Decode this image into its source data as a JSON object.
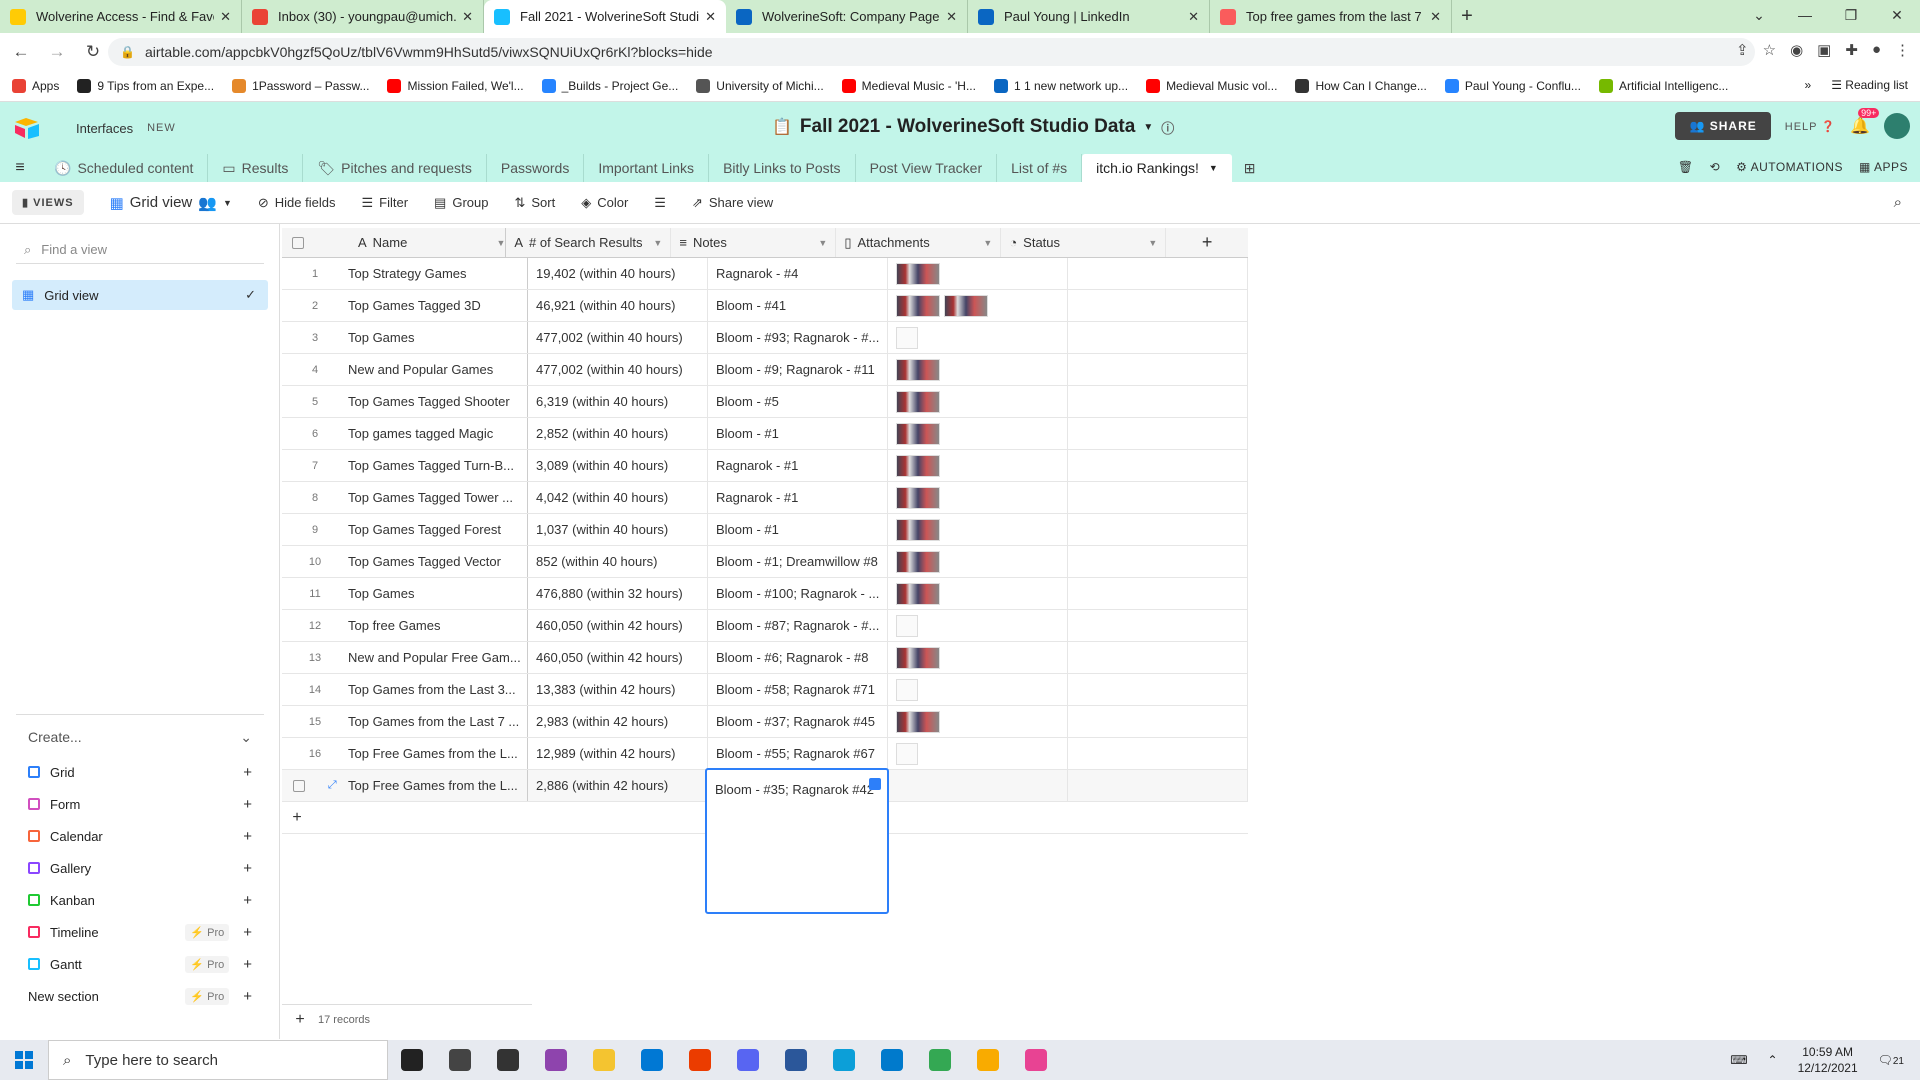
{
  "browser": {
    "tabs": [
      {
        "title": "Wolverine Access - Find & Favori",
        "icon": "umich-icon",
        "color": "#ffcb05",
        "active": false
      },
      {
        "title": "Inbox (30) - youngpau@umich.ec",
        "icon": "gmail-icon",
        "color": "#ea4335",
        "active": false
      },
      {
        "title": "Fall 2021 - WolverineSoft Studio",
        "icon": "airtable-icon",
        "color": "#18bfff",
        "active": true
      },
      {
        "title": "WolverineSoft: Company Page Ac",
        "icon": "linkedin-icon",
        "color": "#0a66c2",
        "active": false
      },
      {
        "title": "Paul Young | LinkedIn",
        "icon": "linkedin-icon",
        "color": "#0a66c2",
        "active": false
      },
      {
        "title": "Top free games from the last 7 d",
        "icon": "itchio-icon",
        "color": "#fa5c5c",
        "active": false
      }
    ],
    "url": "airtable.com/appcbkV0hgzf5QoUz/tblV6Vwmm9HhSutd5/viwxSQNUiUxQr6rKl?blocks=hide",
    "bookmarks": [
      {
        "label": "Apps",
        "color": "#e94235"
      },
      {
        "label": "9 Tips from an Expe...",
        "color": "#222222"
      },
      {
        "label": "1Password – Passw...",
        "color": "#e5892b"
      },
      {
        "label": "Mission Failed, We'l...",
        "color": "#ff0000"
      },
      {
        "label": "_Builds - Project Ge...",
        "color": "#2684ff"
      },
      {
        "label": "University of Michi...",
        "color": "#555555"
      },
      {
        "label": "Medieval Music - 'H...",
        "color": "#ff0000"
      },
      {
        "label": "1 1 new network up...",
        "color": "#0a66c2"
      },
      {
        "label": "Medieval Music vol...",
        "color": "#ff0000"
      },
      {
        "label": "How Can I Change...",
        "color": "#333333"
      },
      {
        "label": "Paul Young - Conflu...",
        "color": "#2684ff"
      },
      {
        "label": "Artificial Intelligenc...",
        "color": "#76b900"
      }
    ],
    "reading_list": "Reading list"
  },
  "app": {
    "interfaces": "Interfaces",
    "new_badge": "NEW",
    "base_title": "Fall 2021 - WolverineSoft Studio Data",
    "share": "SHARE",
    "help": "HELP",
    "notif_count": "99+",
    "tables": [
      "Scheduled content",
      "Results",
      "Pitches and requests",
      "Passwords",
      "Important Links",
      "Bitly Links to Posts",
      "Post View Tracker",
      "List of #s",
      "itch.io Rankings!"
    ],
    "automations": "AUTOMATIONS",
    "apps": "APPS"
  },
  "viewbar": {
    "views": "VIEWS",
    "grid_view": "Grid view",
    "hide_fields": "Hide fields",
    "filter": "Filter",
    "group": "Group",
    "sort": "Sort",
    "color": "Color",
    "share_view": "Share view"
  },
  "sidebar": {
    "find_placeholder": "Find a view",
    "grid_view": "Grid view",
    "create": "Create...",
    "items": [
      {
        "label": "Grid",
        "color": "#2d7ff9",
        "pro": ""
      },
      {
        "label": "Form",
        "color": "#d14fbf",
        "pro": ""
      },
      {
        "label": "Calendar",
        "color": "#f7653b",
        "pro": ""
      },
      {
        "label": "Gallery",
        "color": "#8b46ff",
        "pro": ""
      },
      {
        "label": "Kanban",
        "color": "#20c933",
        "pro": ""
      },
      {
        "label": "Timeline",
        "color": "#f82b60",
        "pro": "Pro"
      },
      {
        "label": "Gantt",
        "color": "#18bfff",
        "pro": "Pro"
      },
      {
        "label": "New section",
        "color": "",
        "pro": "Pro"
      }
    ]
  },
  "grid": {
    "columns": [
      "Name",
      "# of Search Results",
      "Notes",
      "Attachments",
      "Status"
    ],
    "rows": [
      {
        "n": "1",
        "name": "Top Strategy Games",
        "results": "19,402 (within 40 hours)",
        "notes": "Ragnarok - #4",
        "att": 1
      },
      {
        "n": "2",
        "name": "Top Games Tagged 3D",
        "results": "46,921 (within 40 hours)",
        "notes": "Bloom - #41",
        "att": 2
      },
      {
        "n": "3",
        "name": "Top Games",
        "results": "477,002 (within 40 hours)",
        "notes": "Bloom - #93; Ragnarok - #...",
        "att": 0
      },
      {
        "n": "4",
        "name": "New and Popular Games",
        "results": "477,002 (within 40 hours)",
        "notes": "Bloom - #9; Ragnarok - #11",
        "att": 1
      },
      {
        "n": "5",
        "name": "Top Games Tagged Shooter",
        "results": "6,319 (within 40 hours)",
        "notes": "Bloom - #5",
        "att": 1
      },
      {
        "n": "6",
        "name": "Top games tagged Magic",
        "results": "2,852 (within 40 hours)",
        "notes": "Bloom - #1",
        "att": 1
      },
      {
        "n": "7",
        "name": "Top Games Tagged Turn-B...",
        "results": "3,089 (within 40 hours)",
        "notes": "Ragnarok - #1",
        "att": 1
      },
      {
        "n": "8",
        "name": "Top Games Tagged Tower ...",
        "results": "4,042 (within 40 hours)",
        "notes": "Ragnarok - #1",
        "att": 1
      },
      {
        "n": "9",
        "name": "Top Games Tagged Forest",
        "results": "1,037 (within 40 hours)",
        "notes": "Bloom - #1",
        "att": 1
      },
      {
        "n": "10",
        "name": "Top Games Tagged Vector",
        "results": "852 (within 40 hours)",
        "notes": "Bloom - #1; Dreamwillow #8",
        "att": 1
      },
      {
        "n": "11",
        "name": "Top Games",
        "results": "476,880 (within 32 hours)",
        "notes": "Bloom - #100; Ragnarok - ...",
        "att": 1
      },
      {
        "n": "12",
        "name": "Top free Games",
        "results": "460,050 (within 42 hours)",
        "notes": "Bloom - #87; Ragnarok - #...",
        "att": 0
      },
      {
        "n": "13",
        "name": "New and Popular Free Gam...",
        "results": "460,050 (within 42 hours)",
        "notes": "Bloom - #6; Ragnarok - #8",
        "att": 1
      },
      {
        "n": "14",
        "name": "Top Games from the Last 3...",
        "results": "13,383 (within 42 hours)",
        "notes": "Bloom - #58; Ragnarok #71",
        "att": 0
      },
      {
        "n": "15",
        "name": "Top Games from the Last 7 ...",
        "results": "2,983 (within 42 hours)",
        "notes": "Bloom - #37; Ragnarok #45",
        "att": 1
      },
      {
        "n": "16",
        "name": "Top Free Games from the L...",
        "results": "12,989 (within 42 hours)",
        "notes": "Bloom - #55; Ragnarok #67",
        "att": 0
      },
      {
        "n": "",
        "name": "Top Free Games from the L...",
        "results": "2,886 (within 42 hours)",
        "notes": "",
        "att": -1
      }
    ],
    "editor_text": "Bloom - #35; Ragnarok #42",
    "record_count": "17 records"
  },
  "taskbar": {
    "search_placeholder": "Type here to search",
    "time": "10:59 AM",
    "date": "12/12/2021",
    "notif": "21",
    "apps": [
      {
        "name": "cortana-icon",
        "color": "#222222"
      },
      {
        "name": "task-view-icon",
        "color": "#444444"
      },
      {
        "name": "store-icon",
        "color": "#333333"
      },
      {
        "name": "app-purple-icon",
        "color": "#8e44ad"
      },
      {
        "name": "file-explorer-icon",
        "color": "#f4c430"
      },
      {
        "name": "mail-icon",
        "color": "#0078d4"
      },
      {
        "name": "office-icon",
        "color": "#eb3c00"
      },
      {
        "name": "discord-icon",
        "color": "#5865f2"
      },
      {
        "name": "word-icon",
        "color": "#2b579a"
      },
      {
        "name": "edge-icon",
        "color": "#0c9fd8"
      },
      {
        "name": "vscode-icon",
        "color": "#007acc"
      },
      {
        "name": "chrome-icon",
        "color": "#34a853"
      },
      {
        "name": "chrome-canary-icon",
        "color": "#f9ab00"
      },
      {
        "name": "itunes-icon",
        "color": "#e84393"
      }
    ]
  }
}
